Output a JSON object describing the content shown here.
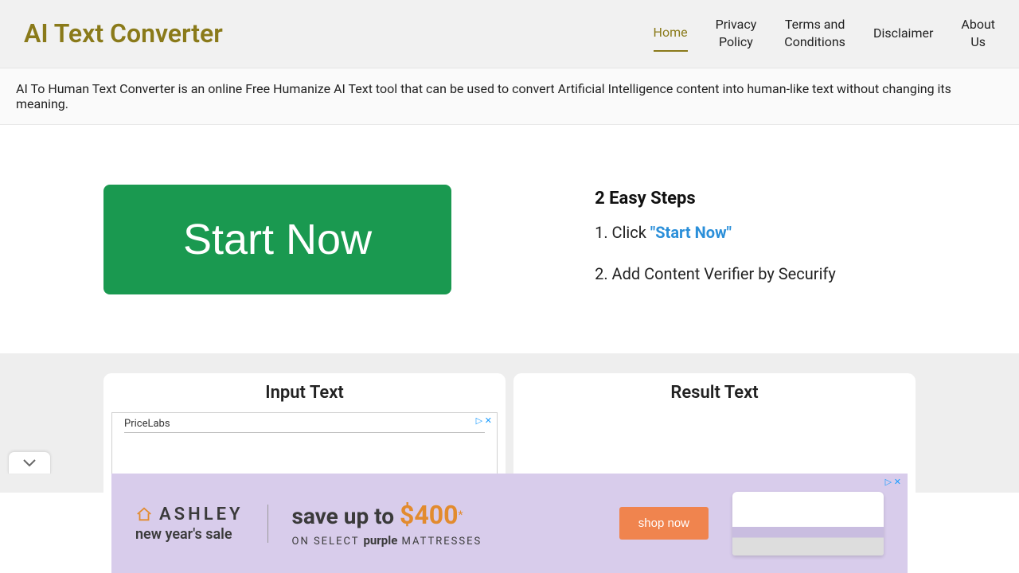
{
  "header": {
    "logo": "AI Text Converter",
    "nav": [
      {
        "label": "Home",
        "active": true
      },
      {
        "label": "Privacy\nPolicy",
        "active": false
      },
      {
        "label": "Terms and\nConditions",
        "active": false
      },
      {
        "label": "Disclaimer",
        "active": false
      },
      {
        "label": "About\nUs",
        "active": false
      }
    ]
  },
  "description": "AI To Human Text Converter is an online Free Humanize AI Text tool that can be used to convert Artificial Intelligence content into human-like text without changing its meaning.",
  "hero": {
    "button": "Start Now",
    "steps_title": "2 Easy Steps",
    "step1_prefix": "1. Click ",
    "step1_highlight": "\"Start Now\"",
    "step2": "2. Add Content Verifier by Securify"
  },
  "tool": {
    "input_title": "Input Text",
    "result_title": "Result Text",
    "inline_ad_label": "PriceLabs",
    "inline_ad_badge": "▷ ✕"
  },
  "banner": {
    "brand": "ASHLEY",
    "tagline": "new year's sale",
    "save_text": "save up to ",
    "amount": "$400",
    "sup": "*",
    "subline_prefix": "ON SELECT ",
    "subline_brand": "purple",
    "subline_suffix": " MATTRESSES",
    "cta": "shop now",
    "info_badge": "▷ ✕"
  },
  "colors": {
    "accent": "#8a7a1a",
    "button_green": "#1a9950",
    "link_blue": "#2b8fd9",
    "ad_bg": "#d8cceb",
    "ad_orange": "#e28b2e",
    "shop_orange": "#f0844e"
  }
}
